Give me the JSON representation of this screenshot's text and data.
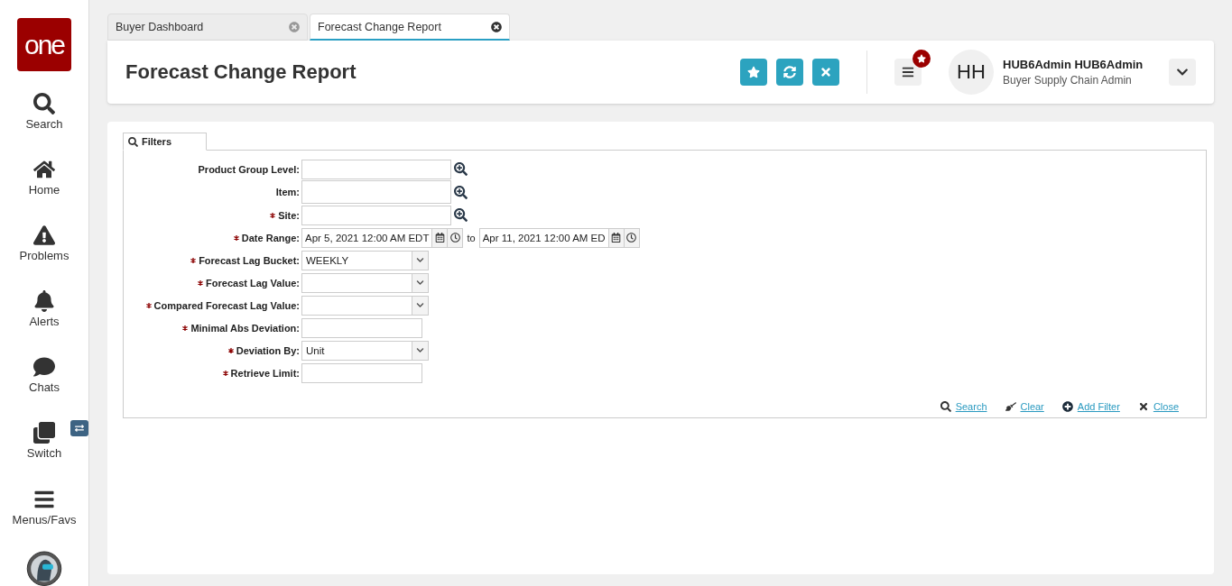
{
  "sidebar": {
    "logo": "one",
    "items": [
      {
        "label": "Search"
      },
      {
        "label": "Home"
      },
      {
        "label": "Problems"
      },
      {
        "label": "Alerts"
      },
      {
        "label": "Chats"
      },
      {
        "label": "Switch"
      },
      {
        "label": "Menus/Favs"
      }
    ]
  },
  "tabs": [
    {
      "label": "Buyer Dashboard",
      "selected": false
    },
    {
      "label": "Forecast Change Report",
      "selected": true
    }
  ],
  "header": {
    "title": "Forecast Change Report",
    "user": {
      "initials": "HH",
      "name": "HUB6Admin HUB6Admin",
      "role": "Buyer Supply Chain Admin"
    }
  },
  "filters": {
    "tab": "Filters",
    "fields": [
      {
        "kind": "lookup",
        "label": "Product Group Level:",
        "required": false
      },
      {
        "kind": "lookup",
        "label": "Item:",
        "required": false
      },
      {
        "kind": "lookup",
        "label": "Site:",
        "required": true
      },
      {
        "kind": "date_range",
        "label": "Date Range:",
        "required": true,
        "from": "Apr 5, 2021 12:00 AM EDT",
        "separator": "to",
        "to": "Apr 11, 2021 12:00 AM ED"
      },
      {
        "kind": "select",
        "label": "Forecast Lag Bucket:",
        "required": true,
        "value": "WEEKLY"
      },
      {
        "kind": "select",
        "label": "Forecast Lag Value:",
        "required": true
      },
      {
        "kind": "select",
        "label": "Compared Forecast Lag Value:",
        "required": true
      },
      {
        "kind": "text",
        "label": "Minimal Abs Deviation:",
        "required": true
      },
      {
        "kind": "select",
        "label": "Deviation By:",
        "required": true,
        "value": "Unit"
      },
      {
        "kind": "text",
        "label": "Retrieve Limit:",
        "required": true
      }
    ],
    "actions": [
      {
        "label": "Search"
      },
      {
        "label": "Clear"
      },
      {
        "label": "Add Filter"
      },
      {
        "label": "Close"
      }
    ]
  }
}
